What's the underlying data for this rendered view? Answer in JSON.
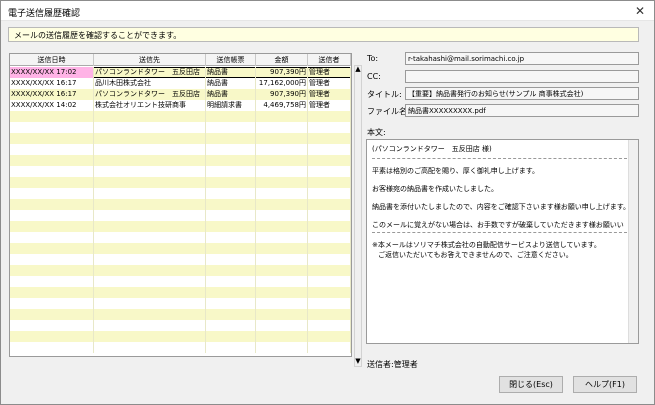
{
  "window": {
    "title": "電子送信履歴確認",
    "close_glyph": "✕"
  },
  "info": "メールの送信履歴を確認することができます。",
  "grid": {
    "headers": [
      "送信日時",
      "送信先",
      "送信帳票",
      "金額",
      "送信者"
    ],
    "rows": [
      [
        "XXXX/XX/XX 17:02",
        "パソコンランドタワー　五反田店",
        "納品書",
        "907,390円",
        "管理者"
      ],
      [
        "XXXX/XX/XX 16:17",
        "品川木田株式会社",
        "納品書",
        "17,162,000円",
        "管理者"
      ],
      [
        "XXXX/XX/XX 16:17",
        "パソコンランドタワー　五反田店",
        "納品書",
        "907,390円",
        "管理者"
      ],
      [
        "XXXX/XX/XX 14:02",
        "株式会社オリエント技研商事",
        "明細請求書",
        "4,469,758円",
        "管理者"
      ]
    ],
    "scroll_up": "▲",
    "scroll_down": "▼"
  },
  "detail": {
    "to_label": "To:",
    "to_value": "r-takahashi@mail.sorimachi.co.jp",
    "cc_label": "CC:",
    "cc_value": "",
    "title_label": "タイトル:",
    "title_value": "【重要】納品書発行のお知らせ(サンプル 商事株式会社)",
    "file_label": "ファイル名:",
    "file_value": "納品書XXXXXXXXX.pdf",
    "body_label": "本文:",
    "body": {
      "addressee": "(パソコンランドタワー　五反田店 様)",
      "l1": "平素は格別のご高配を賜り、厚く御礼申し上げます。",
      "l2": "お客様宛の納品書を作成いたしました。",
      "l3": "納品書を添付いたしましたので、内容をご確認下さいます様お願い申し上げます。",
      "l4": "このメールに覚えがない場合は、お手数ですが破棄していただきます様お願いい",
      "n1": "※本メールはソリマチ株式会社の自動配信サービスより送信しています。",
      "n2": "ご返信いただいてもお答えできませんので、ご注意ください。"
    },
    "sender_text": "送信者:管理者"
  },
  "buttons": {
    "close": "閉じる(Esc)",
    "help": "ヘルプ(F1)"
  },
  "colors": {
    "stripe": "#f8f8c8",
    "selected": "#ffb3e6",
    "info_bg": "#ffffe1"
  }
}
